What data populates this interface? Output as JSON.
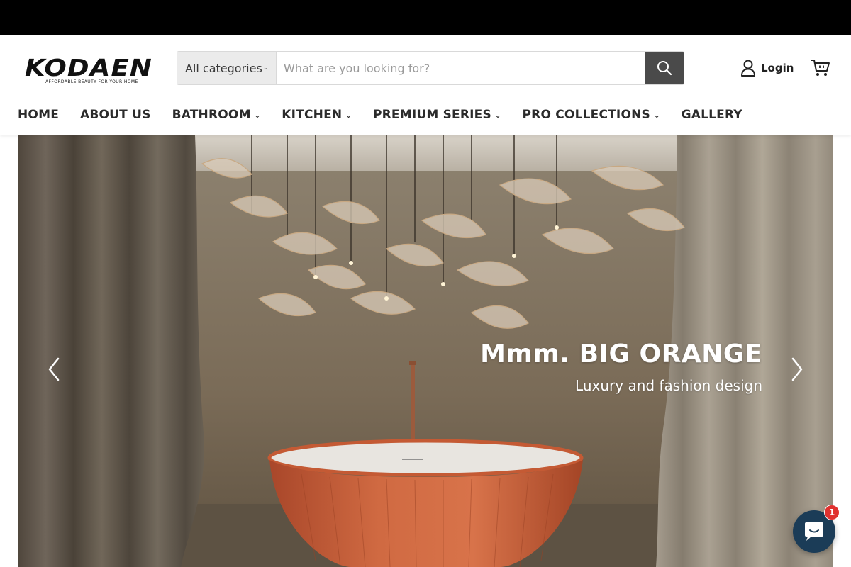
{
  "brand": {
    "logo_text": "KODAEN",
    "tagline": "AFFORDABLE BEAUTY FOR YOUR HOME"
  },
  "search": {
    "category_label": "All categories",
    "placeholder": "What are you looking for?"
  },
  "account": {
    "login_label": "Login"
  },
  "nav": {
    "items": [
      {
        "label": "HOME",
        "dropdown": false
      },
      {
        "label": "ABOUT US",
        "dropdown": false
      },
      {
        "label": "BATHROOM",
        "dropdown": true
      },
      {
        "label": "KITCHEN",
        "dropdown": true
      },
      {
        "label": "PREMIUM SERIES",
        "dropdown": true
      },
      {
        "label": "PRO COLLECTIONS",
        "dropdown": true
      },
      {
        "label": "GALLERY",
        "dropdown": false
      }
    ]
  },
  "hero": {
    "title": "Mmm. BIG ORANGE",
    "subtitle": "Luxury and fashion design"
  },
  "chat": {
    "badge_count": "1"
  },
  "colors": {
    "topbar": "#000000",
    "search_button": "#4a4a4a",
    "chat_bubble": "#1b3c57",
    "badge": "#e0312f",
    "tub": "#c8603a"
  },
  "icons": [
    "chevron-down-icon",
    "search-icon",
    "user-icon",
    "cart-icon",
    "chevron-left-icon",
    "chevron-right-icon",
    "chat-icon"
  ]
}
